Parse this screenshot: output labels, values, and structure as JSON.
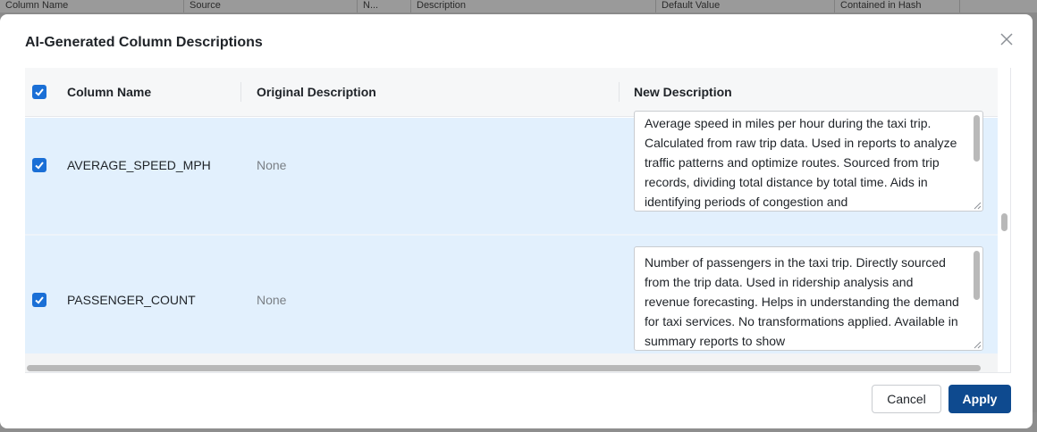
{
  "background": {
    "columns": [
      "Column Name",
      "Source",
      "N...",
      "Description",
      "Default Value",
      "Contained in Hash"
    ]
  },
  "modal": {
    "title": "AI-Generated Column Descriptions",
    "close_icon": "close-icon"
  },
  "table": {
    "headers": {
      "column_name": "Column Name",
      "original_description": "Original Description",
      "new_description": "New Description"
    },
    "rows": [
      {
        "checked": true,
        "column_name": "AVERAGE_SPEED_MPH",
        "original_description": "None",
        "new_description": "Average speed in miles per hour during the taxi trip. Calculated from raw trip data. Used in reports to analyze traffic patterns and optimize routes. Sourced from trip records, dividing total distance by total time. Aids in identifying periods of congestion and"
      },
      {
        "checked": true,
        "column_name": "PASSENGER_COUNT",
        "original_description": "None",
        "new_description": "Number of passengers in the taxi trip. Directly sourced from the trip data. Used in ridership analysis and revenue forecasting. Helps in understanding the demand for taxi services. No transformations applied. Available in summary reports to show"
      }
    ]
  },
  "buttons": {
    "cancel": "Cancel",
    "apply": "Apply"
  },
  "colors": {
    "row_selected": "#e2f0fd",
    "checkbox": "#1a6fd6",
    "apply_button": "#0e4a8f"
  }
}
